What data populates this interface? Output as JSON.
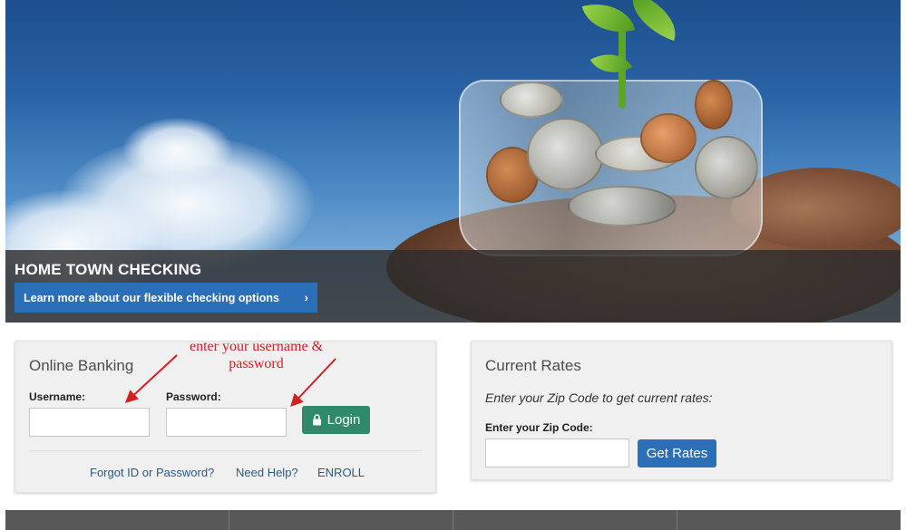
{
  "hero": {
    "title": "HOME TOWN CHECKING",
    "cta_label": "Learn more about our flexible checking options",
    "cta_icon": "chevron-right-icon"
  },
  "online_banking": {
    "title": "Online Banking",
    "username_label": "Username:",
    "username_value": "",
    "password_label": "Password:",
    "password_value": "",
    "login_label": "Login",
    "login_icon": "lock-icon",
    "links": [
      "Forgot ID or Password?",
      "Need Help?",
      "ENROLL"
    ]
  },
  "annotation": {
    "line1": "enter your username &",
    "line2": "password",
    "color": "#d42020"
  },
  "current_rates": {
    "title": "Current Rates",
    "instruction": "Enter your Zip Code to get current rates:",
    "zip_label": "Enter your Zip Code:",
    "zip_value": "",
    "button_label": "Get Rates"
  },
  "colors": {
    "accent_blue": "#2b6fb8",
    "login_green": "#2f8a6c",
    "footer_gray": "#585858"
  }
}
